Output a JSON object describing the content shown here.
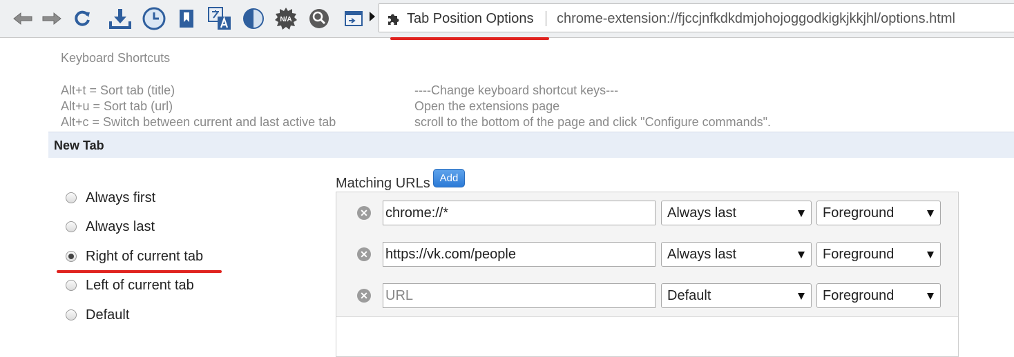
{
  "omnibox": {
    "title": "Tab Position Options",
    "url": "chrome-extension://fjccjnfkdkdmjohojoggodkigkjkkjhl/options.html"
  },
  "toolbar_icons": [
    "back-icon",
    "forward-icon",
    "reload-icon",
    "download-icon",
    "clock-icon",
    "bookmark-icon",
    "translate-icon",
    "contrast-icon",
    "n-a-badge-icon",
    "magnifier-icon",
    "window-icon",
    "more-arrow-icon"
  ],
  "shortcuts": {
    "title": "Keyboard Shortcuts",
    "items": [
      "Alt+t = Sort tab (title)",
      "Alt+u = Sort tab (url)",
      "Alt+c = Switch between current and last active tab"
    ],
    "notes": [
      "----Change keyboard shortcut keys---",
      "Open the extensions page",
      "scroll to the bottom of the page and click \"Configure commands\"."
    ]
  },
  "new_tab": {
    "title": "New Tab",
    "options": [
      "Always first",
      "Always last",
      "Right of current tab",
      "Left of current tab",
      "Default"
    ],
    "selected": "Right of current tab"
  },
  "matching_urls": {
    "label": "Matching URLs",
    "add_label": "Add",
    "rows": [
      {
        "url": "chrome://*",
        "placeholder": "URL",
        "position": "Always last",
        "mode": "Foreground"
      },
      {
        "url": "https://vk.com/people",
        "placeholder": "URL",
        "position": "Always last",
        "mode": "Foreground"
      },
      {
        "url": "",
        "placeholder": "URL",
        "position": "Default",
        "mode": "Foreground"
      }
    ]
  },
  "colors": {
    "annotation_red": "#e0231f",
    "section_header_bg": "#e8eef7",
    "add_button_blue": "#2c7ad6"
  }
}
